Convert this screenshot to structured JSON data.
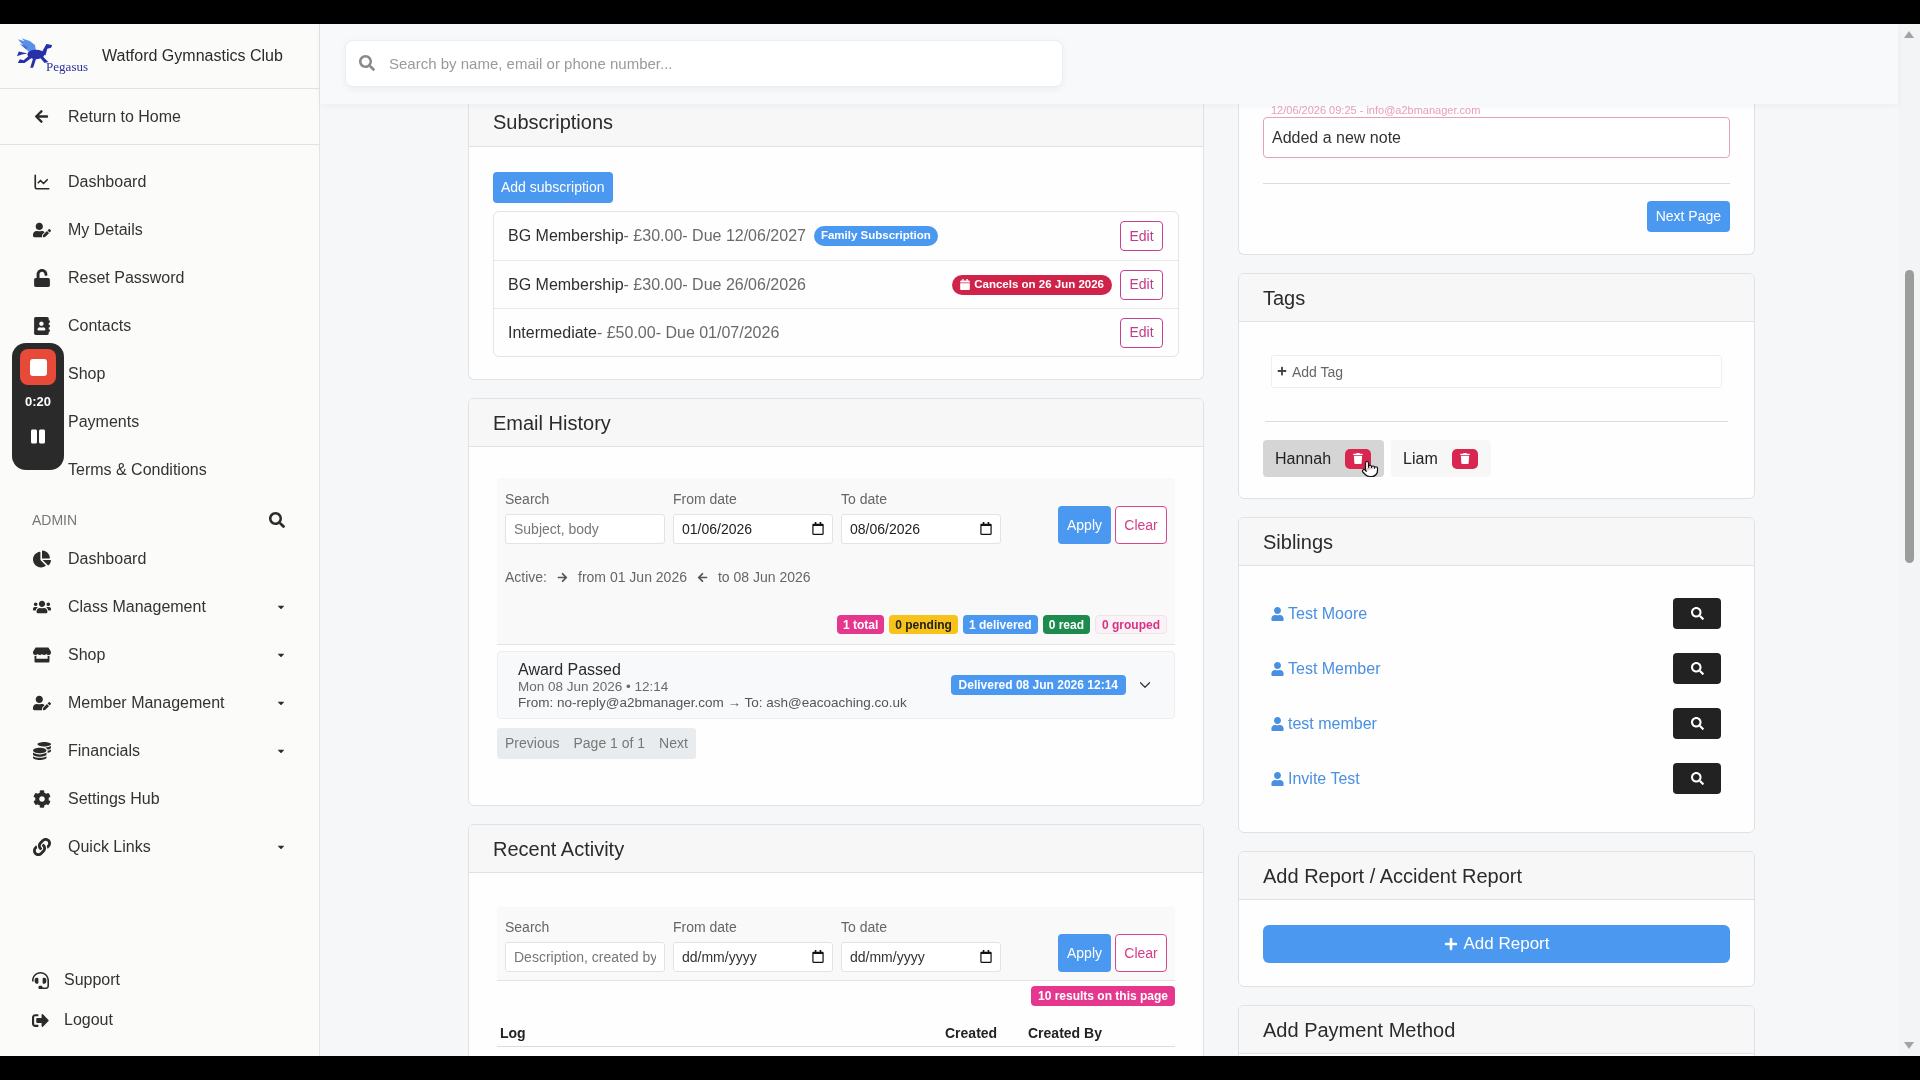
{
  "recorder": {
    "time": "0:20"
  },
  "sidebar": {
    "logo_text": "Pegasus",
    "club_name": "Watford Gymnastics Club",
    "return_link": "Return to Home",
    "menu": [
      "Dashboard",
      "My Details",
      "Reset Password",
      "Contacts",
      "Shop",
      "Payments",
      "Terms & Conditions"
    ],
    "admin": {
      "heading": "ADMIN",
      "items": [
        {
          "label": "Dashboard",
          "dropdown": false
        },
        {
          "label": "Class Management",
          "dropdown": true
        },
        {
          "label": "Shop",
          "dropdown": true
        },
        {
          "label": "Member Management",
          "dropdown": true
        },
        {
          "label": "Financials",
          "dropdown": true
        },
        {
          "label": "Settings Hub",
          "dropdown": false
        },
        {
          "label": "Quick Links",
          "dropdown": true
        }
      ]
    },
    "footer": [
      "Support",
      "Logout"
    ]
  },
  "search": {
    "placeholder": "Search by name, email or phone number..."
  },
  "subscriptions": {
    "title": "Subscriptions",
    "add_button": "Add subscription",
    "items": [
      {
        "name": "BG Membership",
        "details": "- £30.00- Due 12/06/2027",
        "badge": {
          "kind": "plan",
          "text": "Family Subscription"
        },
        "action": "Edit"
      },
      {
        "name": "BG Membership",
        "details": "- £30.00- Due 26/06/2026",
        "badge": {
          "kind": "cancellation",
          "text": "Cancels on 26 Jun 2026"
        },
        "action": "Edit"
      },
      {
        "name": "Intermediate",
        "details": "- £50.00- Due 01/07/2026",
        "action": "Edit"
      }
    ]
  },
  "email_history": {
    "title": "Email History",
    "filters": {
      "search": {
        "label": "Search",
        "placeholder": "Subject, body"
      },
      "from": {
        "label": "From date",
        "value": "01/06/2026"
      },
      "to": {
        "label": "To date",
        "value": "08/06/2026"
      },
      "apply": "Apply",
      "clear": "Clear"
    },
    "active": {
      "label": "Active:",
      "from": "from 01 Jun 2026",
      "to": "to 08 Jun 2026"
    },
    "counts": [
      {
        "text": "1 total",
        "kind": "solid",
        "color": "#e6378f"
      },
      {
        "text": "0 pending",
        "kind": "warning",
        "color": "#f7c31a"
      },
      {
        "text": "1 delivered",
        "kind": "solid",
        "color": "#4a98ef"
      },
      {
        "text": "0 read",
        "kind": "solid",
        "color": "#1d8a4e"
      },
      {
        "text": "0 grouped",
        "kind": "soft",
        "color": "#d63384"
      }
    ],
    "emails": [
      {
        "subject": "Award Passed",
        "date": "Mon 08 Jun 2026 • 12:14",
        "addresses": "From: no-reply@a2bmanager.com → To: ash@eacoaching.co.uk",
        "status": "Delivered 08 Jun 2026 12:14",
        "expanded": false
      }
    ],
    "pagination": {
      "previous": "Previous",
      "page": "Page 1 of 1",
      "next": "Next"
    }
  },
  "recent_activity": {
    "title": "Recent Activity",
    "filters": {
      "search": {
        "label": "Search",
        "placeholder": "Description, created by"
      },
      "from": {
        "label": "From date",
        "placeholder": "dd/mm/yyyy"
      },
      "to": {
        "label": "To date",
        "placeholder": "dd/mm/yyyy"
      },
      "apply": "Apply",
      "clear": "Clear"
    },
    "results_badge": "10 results on this page",
    "table": {
      "columns": [
        "Log",
        "Created",
        "Created By"
      ]
    }
  },
  "notes": {
    "meta": "12/06/2026 09:25 - info@a2bmanager.com",
    "note_value": "Added a new note",
    "next_button": "Next Page"
  },
  "tags": {
    "title": "Tags",
    "add_placeholder": "Add Tag",
    "items": [
      {
        "label": "Hannah",
        "highlighted": true
      },
      {
        "label": "Liam",
        "highlighted": false
      }
    ]
  },
  "siblings": {
    "title": "Siblings",
    "items": [
      "Test Moore",
      "Test Member",
      "test member",
      "Invite Test"
    ]
  },
  "report": {
    "title": "Add Report / Accident Report",
    "button": "Add Report"
  },
  "payment_method": {
    "title": "Add Payment Method"
  }
}
